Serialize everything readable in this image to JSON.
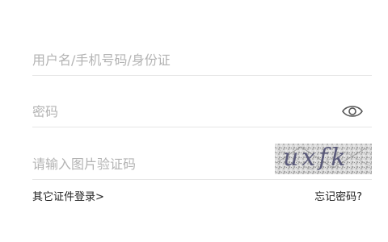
{
  "form": {
    "username": {
      "placeholder": "用户名/手机号码/身份证",
      "value": ""
    },
    "password": {
      "placeholder": "密码",
      "value": ""
    },
    "captcha_input": {
      "placeholder": "请输入图片验证码",
      "value": ""
    },
    "captcha_text": "uxfk"
  },
  "links": {
    "other_login": "其它证件登录>",
    "forgot_password": "忘记密码?"
  },
  "icons": {
    "toggle_password": "eye-icon"
  },
  "colors": {
    "placeholder": "#b3b3b3",
    "divider": "#e6e6e6",
    "link_text": "#222222"
  }
}
